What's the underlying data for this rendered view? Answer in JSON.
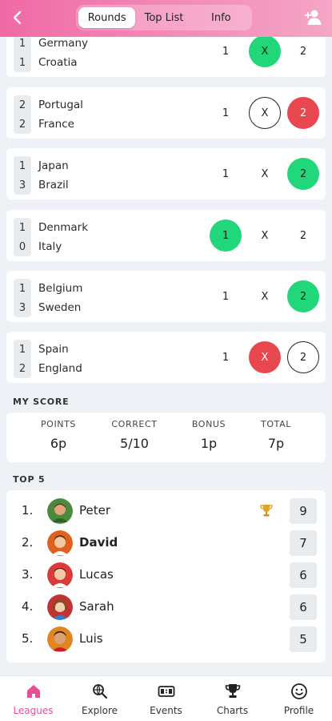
{
  "header": {
    "tabs": [
      {
        "label": "Rounds",
        "active": true
      },
      {
        "label": "Top List",
        "active": false
      },
      {
        "label": "Info",
        "active": false
      }
    ]
  },
  "matches": [
    {
      "score_home": "1",
      "score_away": "1",
      "home": "Germany",
      "away": "Croatia",
      "opt1": "1",
      "optX": "X",
      "opt2": "2",
      "selected": "X",
      "selected_style": "green"
    },
    {
      "score_home": "2",
      "score_away": "2",
      "home": "Portugal",
      "away": "France",
      "opt1": "1",
      "optX": "X",
      "opt2": "2",
      "selected": "2",
      "selected_style": "red",
      "correct": "X"
    },
    {
      "score_home": "1",
      "score_away": "3",
      "home": "Japan",
      "away": "Brazil",
      "opt1": "1",
      "optX": "X",
      "opt2": "2",
      "selected": "2",
      "selected_style": "green"
    },
    {
      "score_home": "1",
      "score_away": "0",
      "home": "Denmark",
      "away": "Italy",
      "opt1": "1",
      "optX": "X",
      "opt2": "2",
      "selected": "1",
      "selected_style": "green"
    },
    {
      "score_home": "1",
      "score_away": "3",
      "home": "Belgium",
      "away": "Sweden",
      "opt1": "1",
      "optX": "X",
      "opt2": "2",
      "selected": "2",
      "selected_style": "green"
    },
    {
      "score_home": "1",
      "score_away": "2",
      "home": "Spain",
      "away": "England",
      "opt1": "1",
      "optX": "X",
      "opt2": "2",
      "selected": "X",
      "selected_style": "red",
      "correct": "2"
    }
  ],
  "my_score": {
    "title": "MY SCORE",
    "stats": [
      {
        "label": "POINTS",
        "value": "6p"
      },
      {
        "label": "CORRECT",
        "value": "5/10"
      },
      {
        "label": "BONUS",
        "value": "1p"
      },
      {
        "label": "TOTAL",
        "value": "7p"
      }
    ]
  },
  "top5": {
    "title": "TOP 5",
    "rows": [
      {
        "rank": "1.",
        "name": "Peter",
        "points": "9",
        "trophy": true,
        "bold": false
      },
      {
        "rank": "2.",
        "name": "David",
        "points": "7",
        "trophy": false,
        "bold": true
      },
      {
        "rank": "3.",
        "name": "Lucas",
        "points": "6",
        "trophy": false,
        "bold": false
      },
      {
        "rank": "4.",
        "name": "Sarah",
        "points": "6",
        "trophy": false,
        "bold": false
      },
      {
        "rank": "5.",
        "name": "Luis",
        "points": "5",
        "trophy": false,
        "bold": false
      }
    ]
  },
  "nav": {
    "items": [
      {
        "label": "Leagues",
        "icon": "home-icon",
        "active": true
      },
      {
        "label": "Explore",
        "icon": "globe-search-icon",
        "active": false
      },
      {
        "label": "Events",
        "icon": "scoreboard-icon",
        "active": false
      },
      {
        "label": "Charts",
        "icon": "trophy-icon",
        "active": false
      },
      {
        "label": "Profile",
        "icon": "smiley-icon",
        "active": false
      }
    ]
  },
  "colors": {
    "accent": "#e84f97",
    "green": "#22d67a",
    "red": "#e8474f"
  }
}
